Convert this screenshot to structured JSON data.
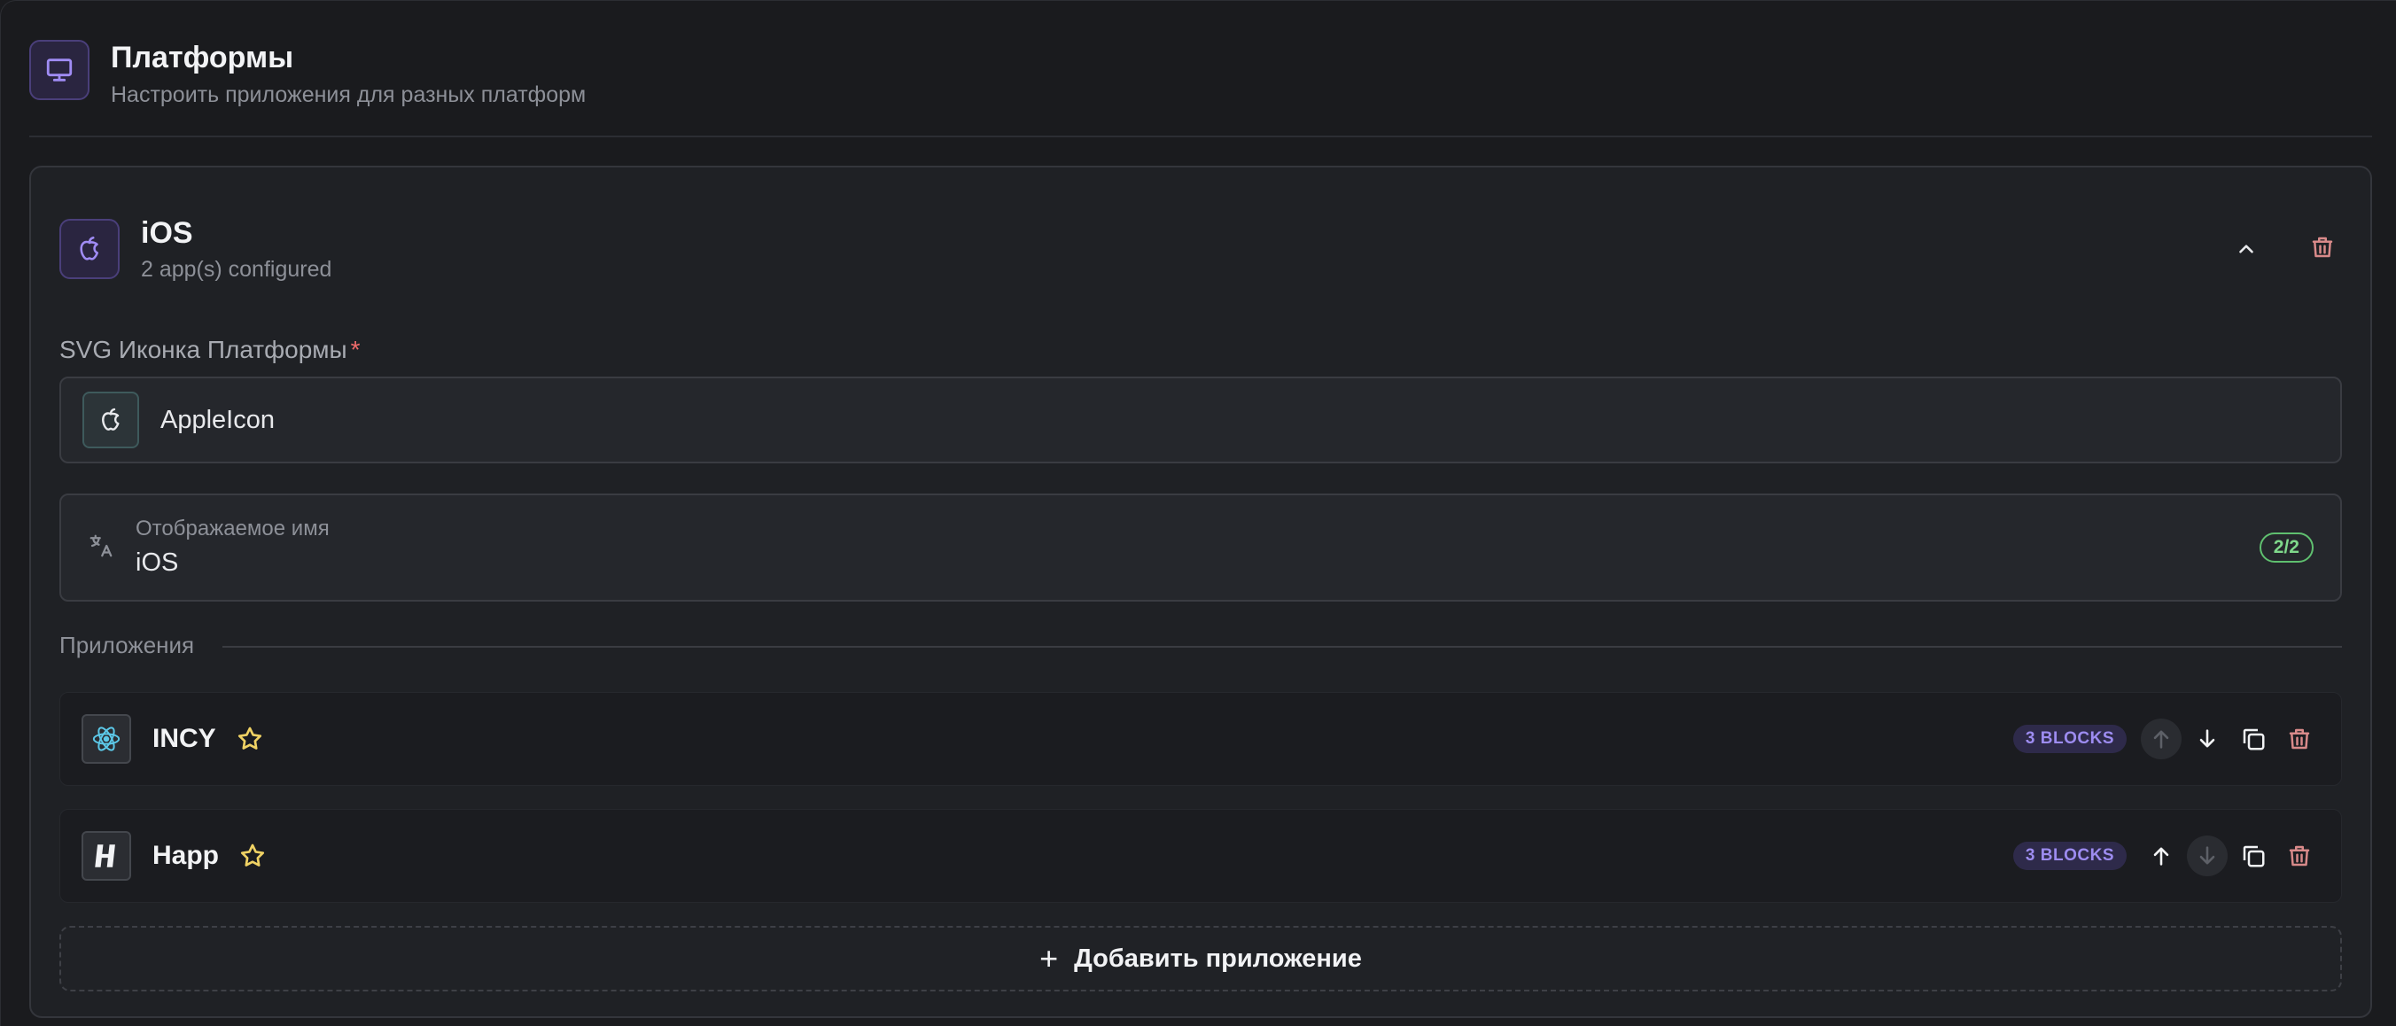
{
  "section": {
    "title": "Платформы",
    "subtitle": "Настроить приложения для разных платформ",
    "icon": "monitor-icon"
  },
  "platform": {
    "title": "iOS",
    "subtitle": "2 app(s) configured",
    "icon": "apple-icon",
    "svg_field": {
      "label": "SVG Иконка Платформы",
      "required_mark": "*",
      "value": "AppleIcon"
    },
    "display_name": {
      "label": "Отображаемое имя",
      "value": "iOS",
      "count": "2/2"
    }
  },
  "apps": {
    "label": "Приложения",
    "items": [
      {
        "name": "INCY",
        "badge": "3 BLOCKS",
        "icon": "incy-app-icon",
        "up_disabled": true,
        "down_disabled": false
      },
      {
        "name": "Happ",
        "badge": "3 BLOCKS",
        "icon": "happ-app-icon",
        "up_disabled": false,
        "down_disabled": true
      }
    ],
    "add_label": "Добавить приложение",
    "add_symbol": "+"
  },
  "colors": {
    "accent": "#9d8cf0",
    "star": "#f0d264",
    "danger": "#d98a8a",
    "success": "#7fd88b",
    "background": "#1a1b1e"
  }
}
